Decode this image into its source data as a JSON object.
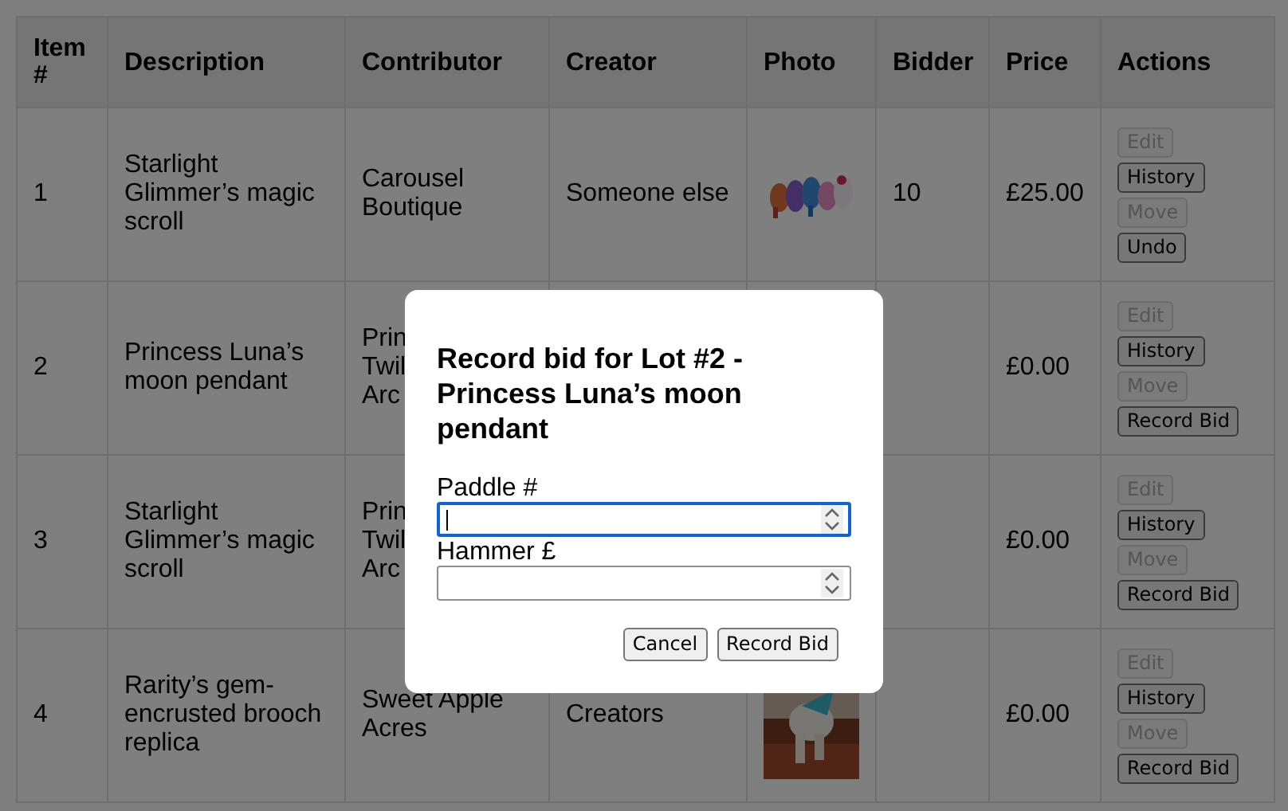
{
  "table": {
    "columns": [
      "Item #",
      "Description",
      "Contributor",
      "Creator",
      "Photo",
      "Bidder",
      "Price",
      "Actions"
    ],
    "rows": [
      {
        "item": "1",
        "description": "Starlight Glimmer’s magic scroll",
        "contributor": [
          "Carousel",
          "Boutique"
        ],
        "creator": [
          "Someone else"
        ],
        "photo": {
          "kind": "picture"
        },
        "bidder": "10",
        "price": "£25.00",
        "actions": [
          {
            "label": "Edit",
            "disabled": true
          },
          {
            "label": "History",
            "disabled": false
          },
          {
            "label": "Move",
            "disabled": true
          },
          {
            "label": "Undo",
            "disabled": false
          }
        ]
      },
      {
        "item": "2",
        "description": "Princess Luna’s moon pendant",
        "contributor": [
          "Prin",
          "Twil",
          "Arc"
        ],
        "creator": [],
        "price": "£0.00",
        "actions": [
          {
            "label": "Edit",
            "disabled": true
          },
          {
            "label": "History",
            "disabled": false
          },
          {
            "label": "Move",
            "disabled": true
          },
          {
            "label": "Record Bid",
            "disabled": false
          }
        ]
      },
      {
        "item": "3",
        "description": "Starlight Glimmer’s magic scroll",
        "contributor": [
          "Prin",
          "Twil",
          "Arc"
        ],
        "creator": [],
        "price": "£0.00",
        "actions": [
          {
            "label": "Edit",
            "disabled": true
          },
          {
            "label": "History",
            "disabled": false
          },
          {
            "label": "Move",
            "disabled": true
          },
          {
            "label": "Record Bid",
            "disabled": false
          }
        ]
      },
      {
        "item": "4",
        "description": "Rarity’s gem-encrusted brooch replica",
        "contributor": [
          "Sweet Apple",
          "Acres"
        ],
        "creator": [
          "Creators"
        ],
        "photo": {
          "kind": "picture"
        },
        "price": "£0.00",
        "actions": [
          {
            "label": "Edit",
            "disabled": true
          },
          {
            "label": "History",
            "disabled": false
          },
          {
            "label": "Move",
            "disabled": true
          },
          {
            "label": "Record Bid",
            "disabled": false
          }
        ]
      }
    ]
  },
  "modal": {
    "title": "Record bid for Lot #2 - Princess Luna’s moon pendant",
    "fields": [
      {
        "label": "Paddle #",
        "focused": true
      },
      {
        "label": "Hammer £",
        "focused": false
      }
    ],
    "buttons": [
      "Cancel",
      "Record Bid"
    ]
  }
}
